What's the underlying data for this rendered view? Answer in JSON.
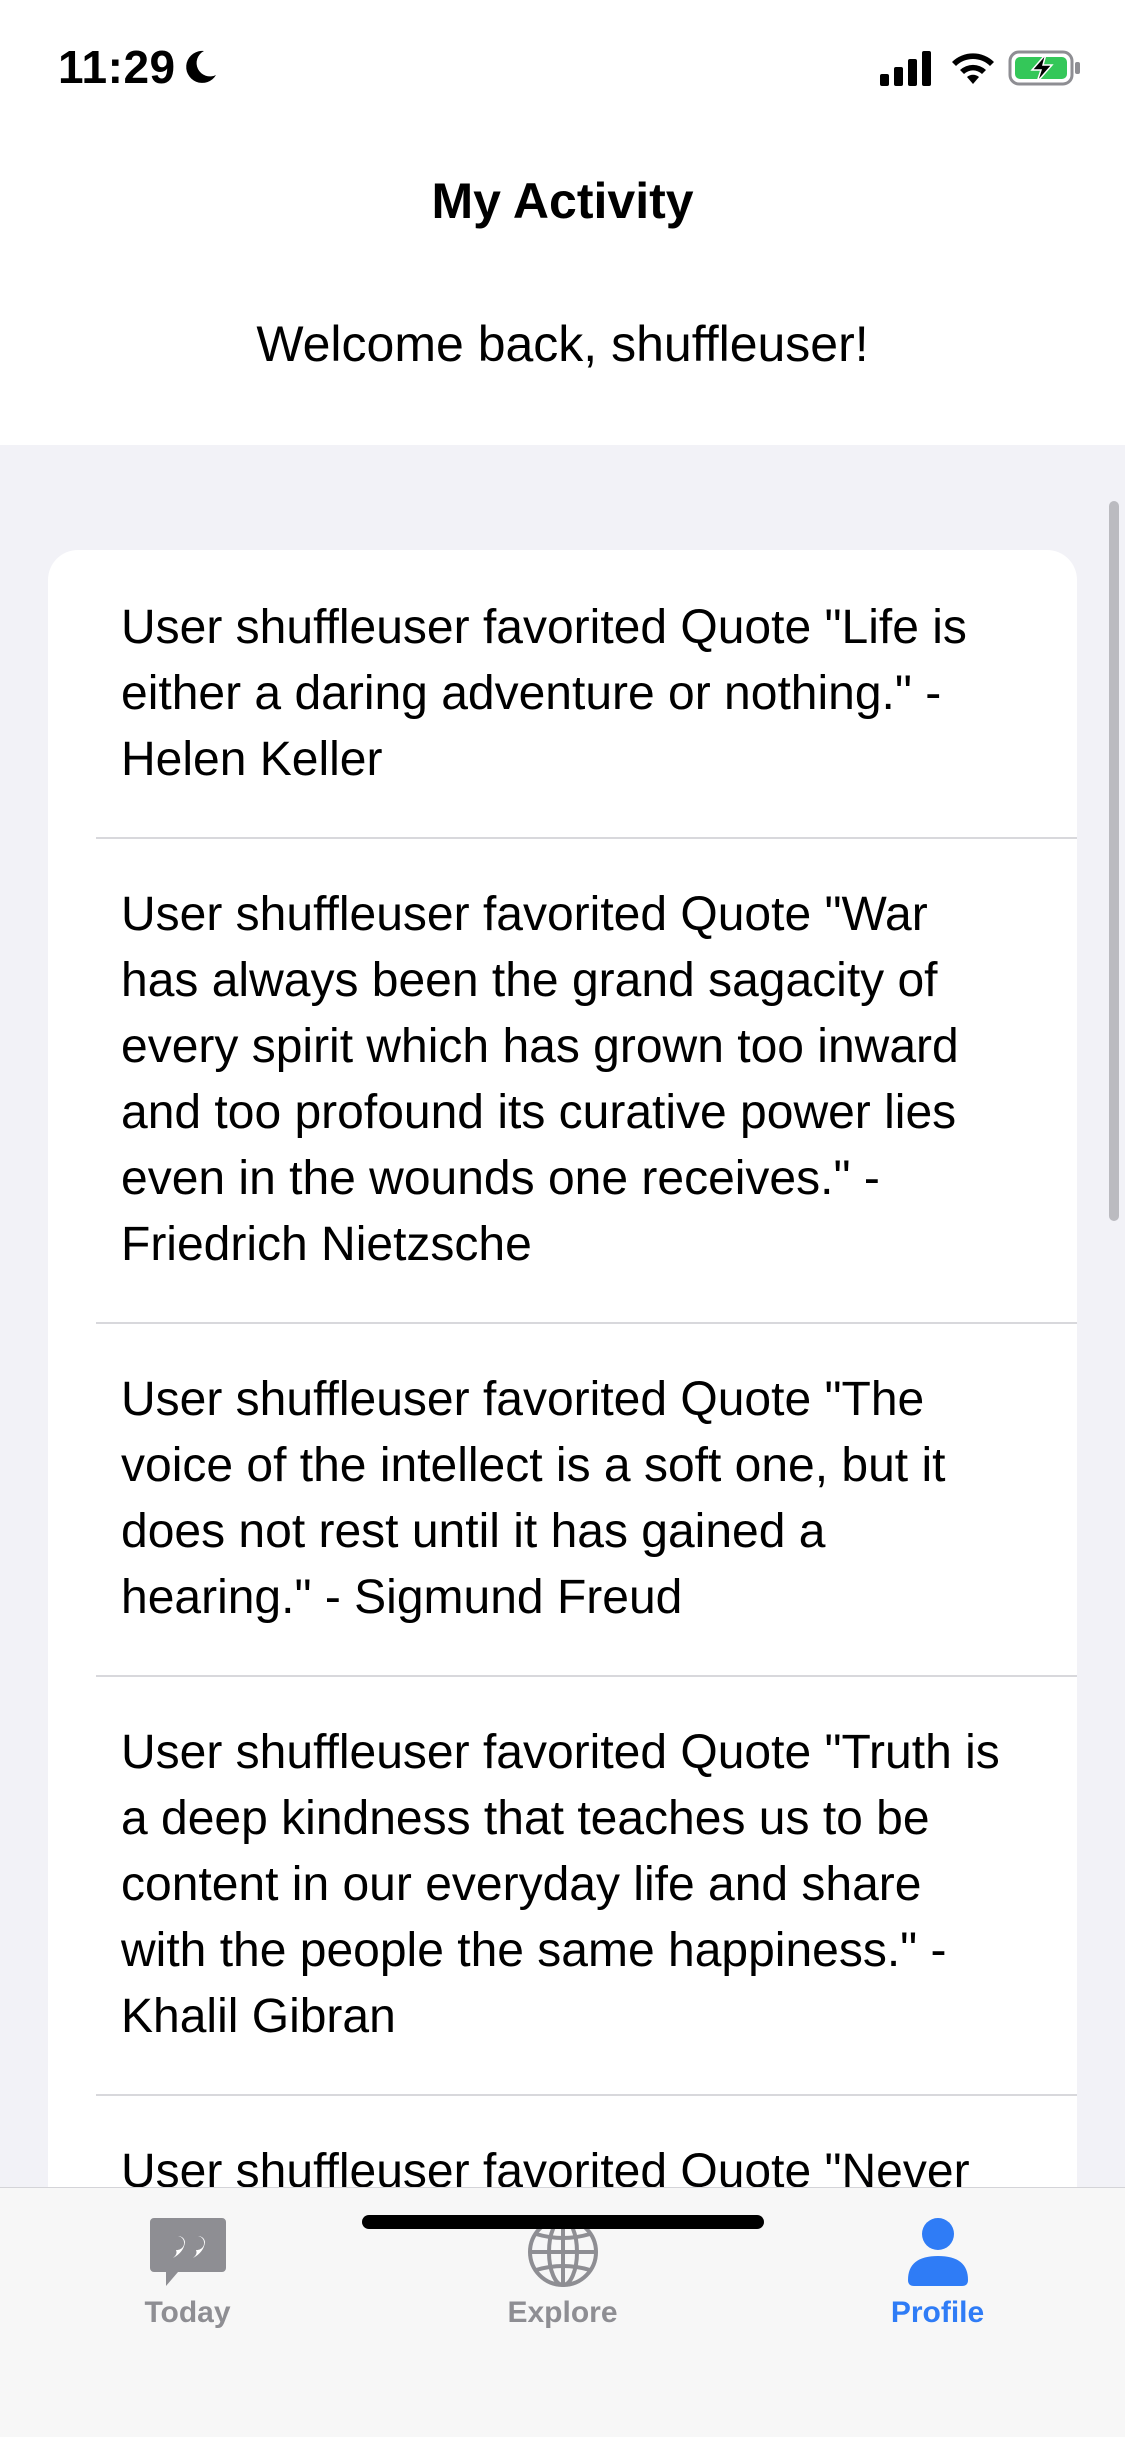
{
  "status_bar": {
    "time": "11:29"
  },
  "header": {
    "title": "My Activity",
    "welcome": "Welcome back, shuffleuser!"
  },
  "activity": [
    "User shuffleuser favorited Quote \"Life is either a daring adventure or nothing.\" - Helen Keller",
    "User shuffleuser favorited Quote \"War has always been the grand sagacity of every spirit which has grown too inward and too profound its curative power lies even in the wounds one receives.\" - Friedrich Nietzsche",
    "User shuffleuser favorited Quote \"The voice of the intellect is a soft one, but it does not rest until it has gained a hearing.\" - Sigmund Freud",
    "User shuffleuser favorited Quote \"Truth is a deep kindness that teaches us to be content in our everyday life and share with the people the same happiness.\" - Khalil Gibran",
    "User shuffleuser favorited Quote \"Never let your College interfere with"
  ],
  "tabs": [
    {
      "label": "Today",
      "icon": "quote-bubble-icon",
      "active": false
    },
    {
      "label": "Explore",
      "icon": "globe-icon",
      "active": false
    },
    {
      "label": "Profile",
      "icon": "person-icon",
      "active": true
    }
  ],
  "colors": {
    "accent": "#2f7cf6",
    "inactive": "#8e8e93",
    "background": "#f2f2f7",
    "battery": "#34c759"
  }
}
